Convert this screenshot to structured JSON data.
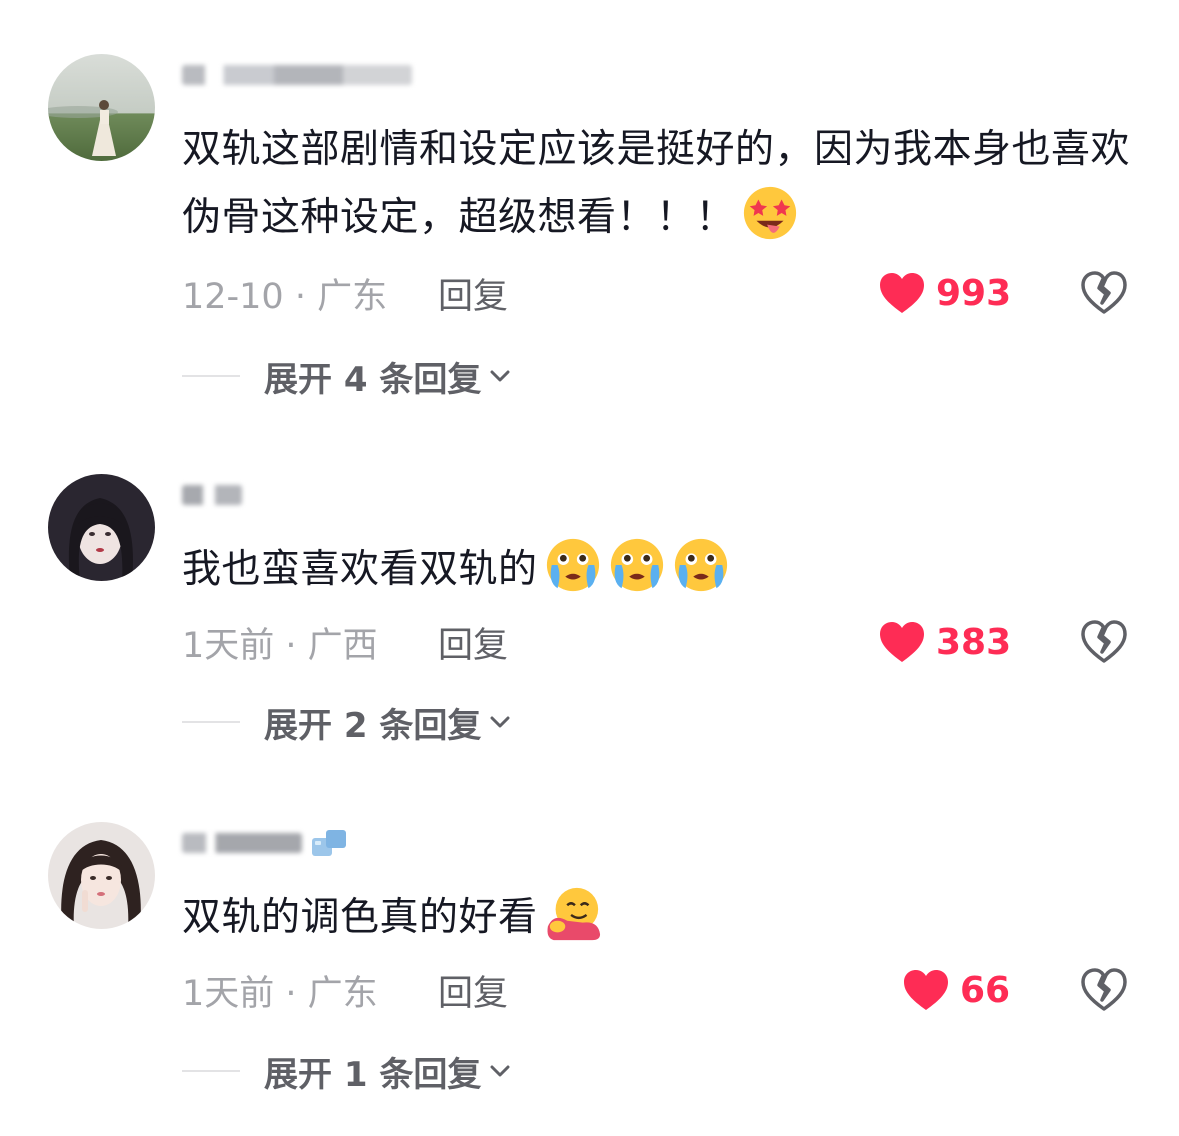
{
  "comments": [
    {
      "text": "双轨这部剧情和设定应该是挺好的，因为我本身也喜欢伪骨这种设定，超级想看！！！",
      "emoji": "starstruck-tongue-emoji",
      "time": "12-10 · 广东",
      "reply_label": "回复",
      "likes": "993",
      "expand_label": "展开 4 条回复"
    },
    {
      "text": "我也蛮喜欢看双轨的",
      "emoji": "crying-face-emoji ×3",
      "time": "1天前 · 广西",
      "reply_label": "回复",
      "likes": "383",
      "expand_label": "展开 2 条回复"
    },
    {
      "text": "双轨的调色真的好看",
      "emoji": "hugging-face-emoji",
      "time": "1天前 · 广东",
      "reply_label": "回复",
      "likes": "66",
      "expand_label": "展开 1 条回复"
    }
  ],
  "colors": {
    "like_red": "#fe2c55",
    "meta_gray": "#a3a4a9",
    "reply_gray": "#5f6066",
    "text_dark": "#161823"
  },
  "icons": {
    "like": "heart-icon",
    "dislike": "broken-heart-icon",
    "expand": "chevron-down-icon"
  }
}
